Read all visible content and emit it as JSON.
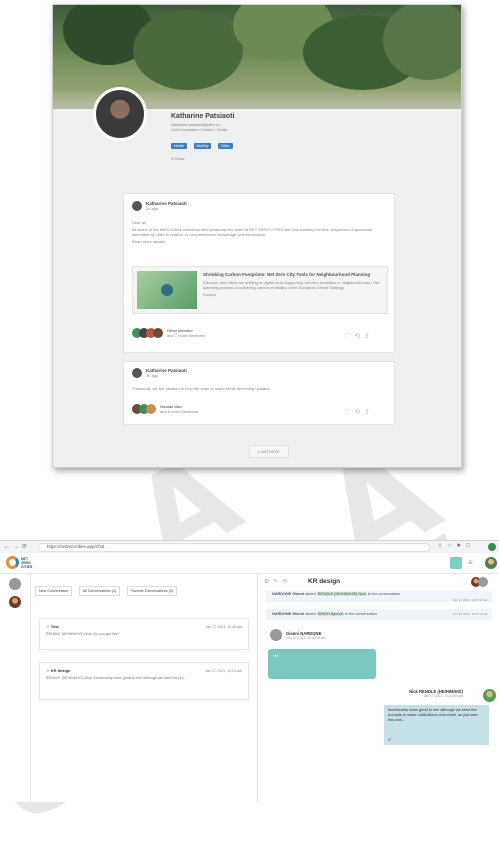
{
  "profile": {
    "name": "Katharine Patsiaoti",
    "email": "katharine.patsiaoti@citiz.eu",
    "role": "Civil Consultant / Maker / Tester",
    "tags": [
      "Health",
      "Mobility",
      "Cities"
    ],
    "meta": "0 Posts"
  },
  "posts": [
    {
      "author": "Katharine Patsiaoti",
      "time": "2h ago",
      "greeting": "Dear all,",
      "body": "As result of the MetCoCities workshop held yesterday the team of NET ZERO CITIES are now awaiting the fine, responses to questions submitted by cities in relation to comprehensive knowledge and information.",
      "link_intro": "Read more details:",
      "link_title": "Shrinking Carbon Footprints: Net Zero City Tools for Neighbourhood Planning",
      "link_desc": "Discover how cities are shifting to digital tools supporting net zero transition in neighbourhoods. The planning process of achieving carbon neutrality of the European Urban Strategy.",
      "link_domain": "Europa",
      "reactions_label": "Other Member",
      "reactions_sub": "and 7 more Members"
    },
    {
      "author": "Katharine Patsiaoti",
      "time": "3h ago",
      "body": "Thanks all, we are pleased to help the team to share these upcoming updates.",
      "reactions_label": "Nicolas Mko",
      "reactions_sub": "and 6 more Members"
    }
  ],
  "load_more": "Load More",
  "browser": {
    "url": "https://netzerocities.app/chat"
  },
  "app": {
    "logo_line1": "NET",
    "logo_line2": "ZERO",
    "logo_line3": "CITIES"
  },
  "conversations": {
    "tabs": [
      "New Conversation",
      "All Conversations (2)",
      "Favorite Conversations (0)"
    ],
    "items": [
      {
        "title": "Test",
        "date": "Jan 17 2023, 11:49 am",
        "preview": "RENDLE (HE/HIM/HIS) Nick: Do you get this?"
      },
      {
        "title": "KR design",
        "date": "Jan 17 2023, 10:13 am",
        "preview": "RENDLE (HE/HIM/HIS) Nick: functionality looks great to me! although we need the pro ..."
      }
    ]
  },
  "chat": {
    "title": "KR design",
    "events": [
      {
        "actor": "NARDONE Gianni",
        "verb": "added",
        "target": "RENDLE (HE/HIM/HIS) Nick",
        "suffix": "to the conversation",
        "time": "Dec 22 2022, 10:06:13 am"
      },
      {
        "actor": "NARDONE Gianni",
        "verb": "added",
        "target": "SINGH Apurva",
        "suffix": "to the conversation",
        "time": "Dec 22 2022, 10:06:13 am"
      }
    ],
    "message_them": {
      "author": "Gianni NARDONE",
      "time": "Dec 22 2022, 10:06:18 am",
      "text": "Hi!"
    },
    "message_me": {
      "author": "Nick RENDLE (HE/HIM/HIS)",
      "time": "Jan 17 2023, 10:10:49 am",
      "text": "functionality looks great to me! although we need the prompts to make notifications onto email, as just seen this now...",
      "status": "✔"
    }
  },
  "colors": {
    "accent": "#3c7fc6",
    "teal_bubble": "#7ac9bf",
    "my_bubble": "#c6e0e7",
    "highlight": "#cfe8d6"
  }
}
